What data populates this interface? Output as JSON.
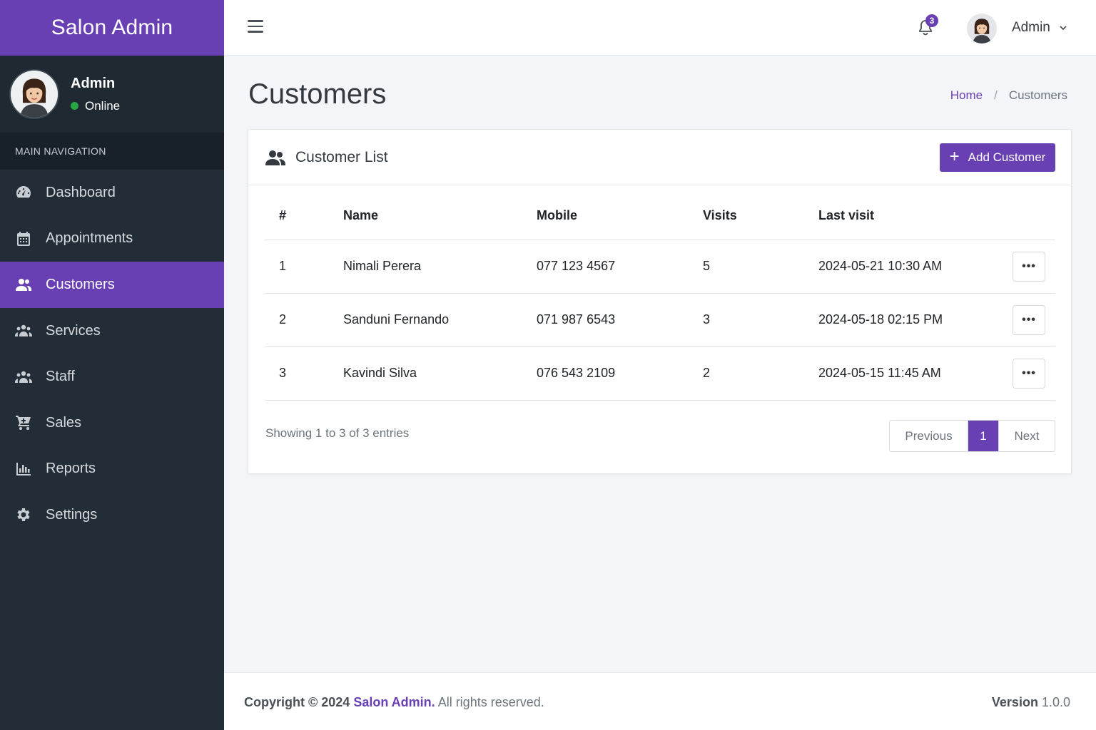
{
  "brand": "Salon Admin",
  "sidebar": {
    "user_name": "Admin",
    "user_status": "Online",
    "nav_header": "MAIN NAVIGATION",
    "items": [
      {
        "label": "Dashboard",
        "icon": "dashboard-icon"
      },
      {
        "label": "Appointments",
        "icon": "calendar-icon"
      },
      {
        "label": "Customers",
        "icon": "users-icon",
        "active": true
      },
      {
        "label": "Services",
        "icon": "users-group-icon"
      },
      {
        "label": "Staff",
        "icon": "staff-icon"
      },
      {
        "label": "Sales",
        "icon": "cart-icon"
      },
      {
        "label": "Reports",
        "icon": "bar-chart-icon"
      },
      {
        "label": "Settings",
        "icon": "gear-icon"
      }
    ]
  },
  "topbar": {
    "notification_count": "3",
    "user_name": "Admin"
  },
  "page": {
    "title": "Customers",
    "breadcrumb_home": "Home",
    "breadcrumb_sep": "/",
    "breadcrumb_current": "Customers"
  },
  "card": {
    "title": "Customer List",
    "add_button": "Add Customer",
    "columns": [
      "#",
      "Name",
      "Mobile",
      "Visits",
      "Last visit"
    ],
    "rows": [
      [
        "1",
        "Nimali Perera",
        "077 123 4567",
        "5",
        "2024-05-21 10:30 AM"
      ],
      [
        "2",
        "Sanduni Fernando",
        "071 987 6543",
        "3",
        "2024-05-18 02:15 PM"
      ],
      [
        "3",
        "Kavindi Silva",
        "076 543 2109",
        "2",
        "2024-05-15 11:45 AM"
      ]
    ],
    "row_action": "•••",
    "entries_info": "Showing 1 to 3 of 3 entries",
    "pager": {
      "prev": "Previous",
      "current": "1",
      "next": "Next"
    }
  },
  "footer": {
    "copyright_prefix": "Copyright © 2024",
    "brand": "Salon Admin.",
    "rights": "All rights reserved.",
    "version_label": "Version",
    "version": "1.0.0"
  },
  "colors": {
    "accent": "#6940b4",
    "sidebar": "#222d38",
    "online": "#28a745"
  }
}
